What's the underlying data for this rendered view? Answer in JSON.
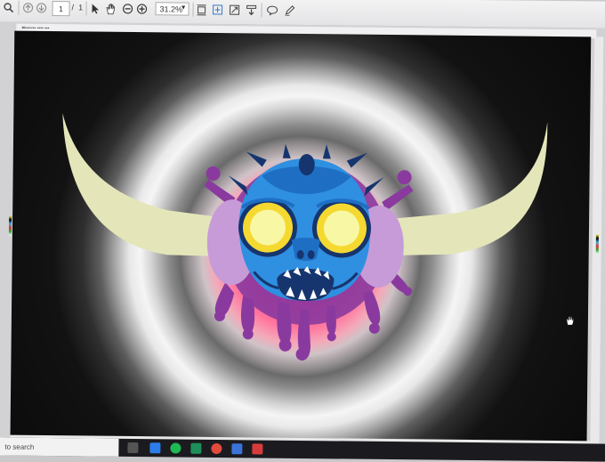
{
  "toolbar": {
    "page_current": "1",
    "page_separator": "/",
    "page_total": "1",
    "zoom": "31.2%"
  },
  "taskbar": {
    "search_placeholder": "to search"
  },
  "colors": {
    "art_center": "#ff1b73",
    "monster_blue": "#2f8fe0",
    "horn": "#e4e6b9",
    "drip_purple": "#8a3a9e",
    "eye_yellow": "#f8f7a4"
  }
}
